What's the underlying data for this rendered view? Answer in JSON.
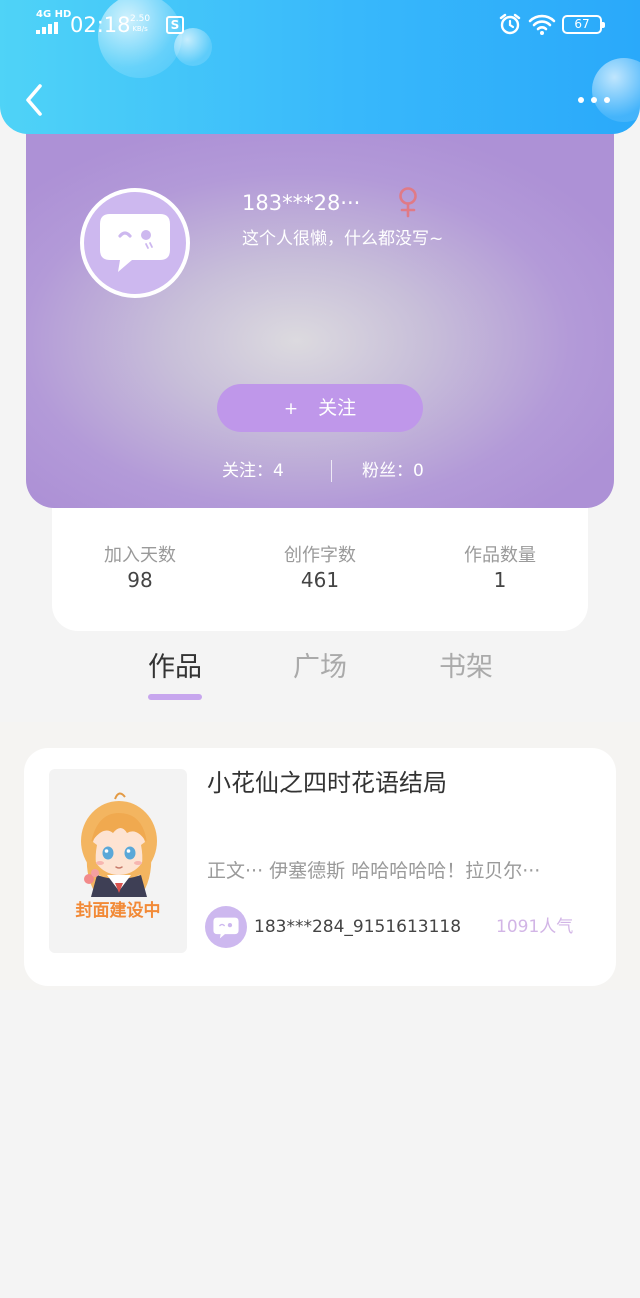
{
  "status_bar": {
    "network": "4G HD",
    "time": "02:18",
    "speed_value": "2.50",
    "speed_unit": "KB/s",
    "app_icon": "S",
    "battery": "67"
  },
  "nav": {
    "back_icon": "chevron-left-icon",
    "more_icon": "more-dots-icon"
  },
  "profile": {
    "username": "183***28···",
    "gender_icon": "female-icon",
    "bio": "这个人很懒，什么都没写~",
    "follow_plus": "+",
    "follow_label": "关注",
    "following": "关注：4",
    "fans": "粉丝：0"
  },
  "stats": [
    {
      "label": "加入天数",
      "value": "98"
    },
    {
      "label": "创作字数",
      "value": "461"
    },
    {
      "label": "作品数量",
      "value": "1"
    }
  ],
  "tabs": [
    {
      "label": "作品",
      "active": true
    },
    {
      "label": "广场",
      "active": false
    },
    {
      "label": "书架",
      "active": false
    }
  ],
  "works": [
    {
      "cover_label": "封面建设中",
      "title": "小花仙之四时花语结局",
      "excerpt": "正文··· 伊塞德斯 哈哈哈哈哈！拉贝尔···",
      "author": "183***284_9151613118",
      "popularity": "1091人气"
    }
  ],
  "colors": {
    "header_blue": "#38b8fb",
    "profile_purple": "#b39ad8",
    "accent_purple": "#c7a6ee",
    "follow_button": "#bf97ea",
    "gender_pink": "#e07a86",
    "popularity_text": "#d2b5e6",
    "cover_label_orange": "#f28a37"
  }
}
